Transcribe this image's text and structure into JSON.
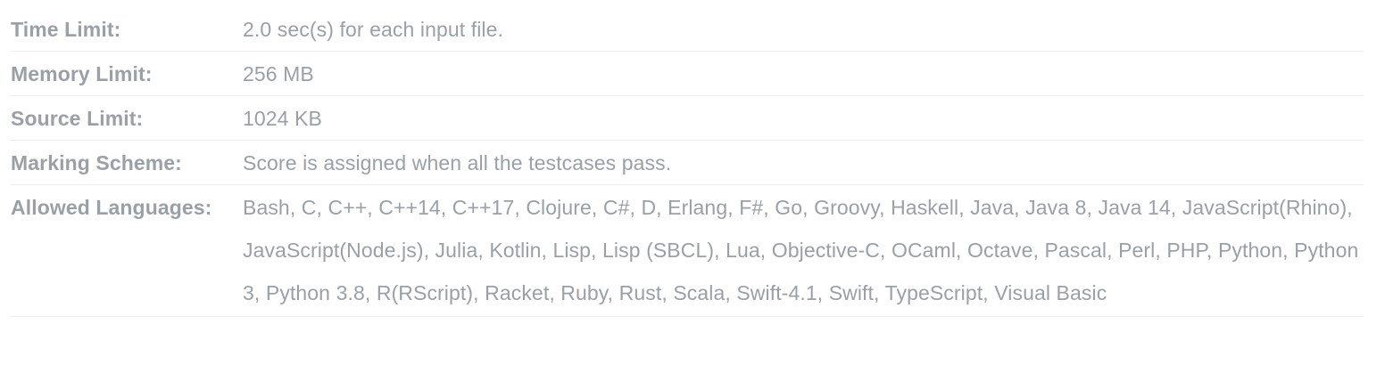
{
  "problem_limits": {
    "rows": [
      {
        "label": "Time Limit:",
        "value": "2.0 sec(s) for each input file."
      },
      {
        "label": "Memory Limit:",
        "value": "256 MB"
      },
      {
        "label": "Source Limit:",
        "value": "1024 KB"
      },
      {
        "label": "Marking Scheme:",
        "value": "Score is assigned when all the testcases pass."
      },
      {
        "label": "Allowed Languages:",
        "value": "Bash, C, C++, C++14, C++17, Clojure, C#, D, Erlang, F#, Go, Groovy, Haskell, Java, Java 8, Java 14, JavaScript(Rhino), JavaScript(Node.js), Julia, Kotlin, Lisp, Lisp (SBCL), Lua, Objective-C, OCaml, Octave, Pascal, Perl, PHP, Python, Python 3, Python 3.8, R(RScript), Racket, Ruby, Rust, Scala, Swift-4.1, Swift, TypeScript, Visual Basic"
      }
    ]
  }
}
